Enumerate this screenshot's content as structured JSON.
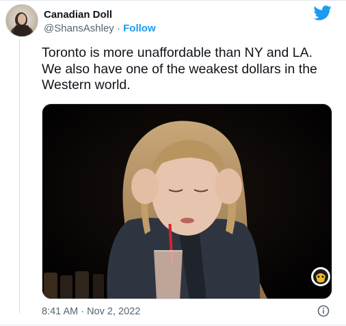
{
  "author": {
    "display_name": "Canadian Doll",
    "handle": "@ShansAshley",
    "separator": "·",
    "follow_label": "Follow"
  },
  "tweet": {
    "text": "Toronto is more unaffordable than NY and LA. We also have one of the weakest dollars in the Western world.",
    "timestamp": "8:41 AM · Nov 2, 2022"
  },
  "media": {
    "type": "gif",
    "description_icon": "hot-ones-logo-icon"
  },
  "icons": {
    "brand": "twitter-bird-icon",
    "info": "info-icon"
  },
  "colors": {
    "accent": "#1d9bf0",
    "text_primary": "#0f1419",
    "text_secondary": "#536471"
  }
}
